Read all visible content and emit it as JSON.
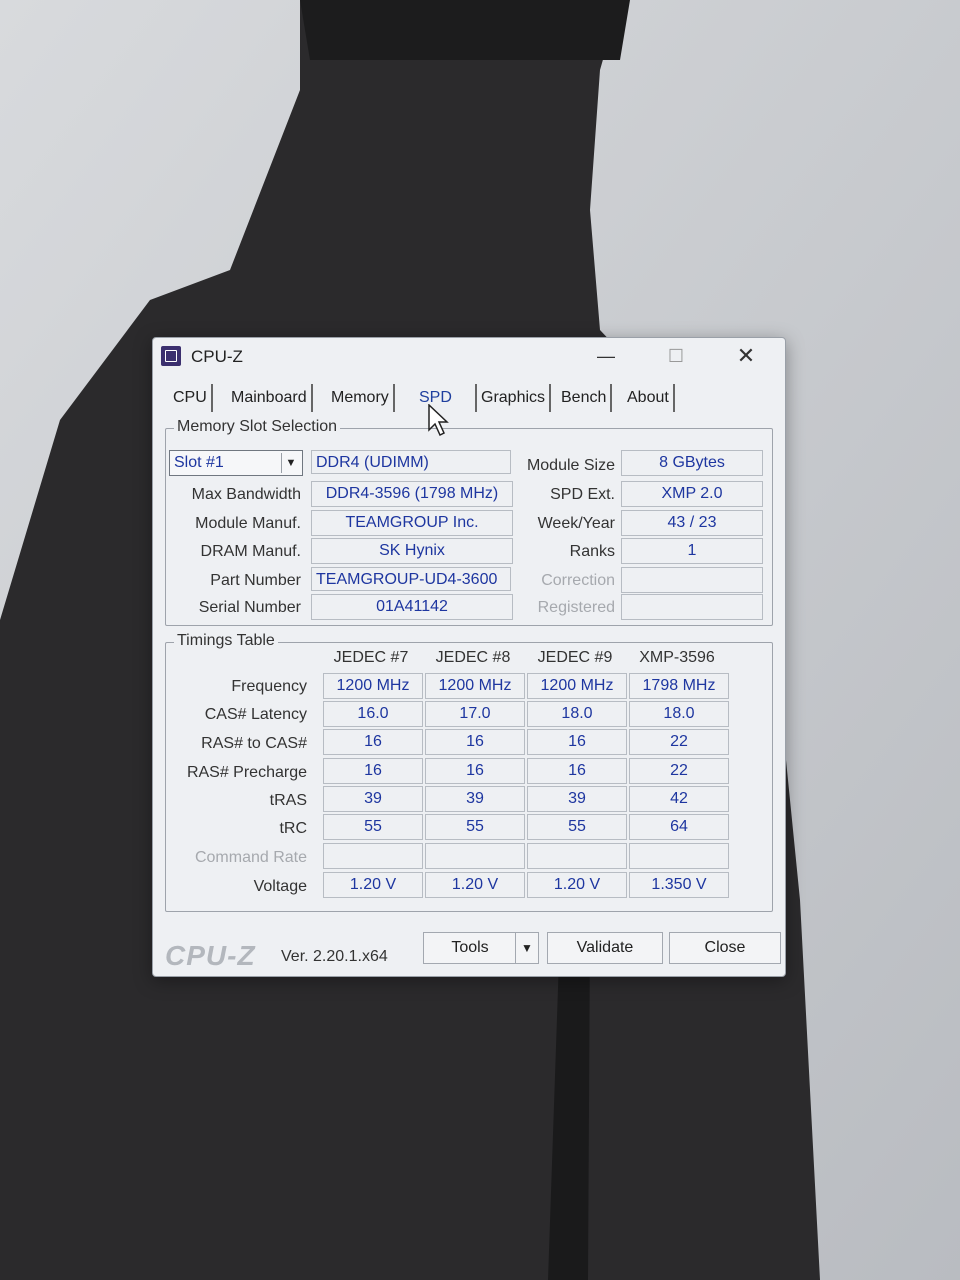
{
  "window": {
    "title": "CPU-Z"
  },
  "tabs": [
    "CPU",
    "Mainboard",
    "Memory",
    "SPD",
    "Graphics",
    "Bench",
    "About"
  ],
  "active_tab": "SPD",
  "slot_section": {
    "label": "Memory Slot Selection",
    "slot_value": "Slot #1",
    "module_type": "DDR4 (UDIMM)",
    "fields": {
      "max_bandwidth": {
        "label": "Max Bandwidth",
        "value": "DDR4-3596 (1798 MHz)"
      },
      "module_manuf": {
        "label": "Module Manuf.",
        "value": "TEAMGROUP Inc."
      },
      "dram_manuf": {
        "label": "DRAM Manuf.",
        "value": "SK Hynix"
      },
      "part_number": {
        "label": "Part Number",
        "value": "TEAMGROUP-UD4-3600"
      },
      "serial_number": {
        "label": "Serial Number",
        "value": "01A41142"
      },
      "module_size": {
        "label": "Module Size",
        "value": "8 GBytes"
      },
      "spd_ext": {
        "label": "SPD Ext.",
        "value": "XMP 2.0"
      },
      "week_year": {
        "label": "Week/Year",
        "value": "43 / 23"
      },
      "ranks": {
        "label": "Ranks",
        "value": "1"
      },
      "correction": {
        "label": "Correction",
        "value": ""
      },
      "registered": {
        "label": "Registered",
        "value": ""
      }
    }
  },
  "timings": {
    "label": "Timings Table",
    "columns": [
      "JEDEC #7",
      "JEDEC #8",
      "JEDEC #9",
      "XMP-3596"
    ],
    "rows": [
      {
        "label": "Frequency",
        "values": [
          "1200 MHz",
          "1200 MHz",
          "1200 MHz",
          "1798 MHz"
        ]
      },
      {
        "label": "CAS# Latency",
        "values": [
          "16.0",
          "17.0",
          "18.0",
          "18.0"
        ]
      },
      {
        "label": "RAS# to CAS#",
        "values": [
          "16",
          "16",
          "16",
          "22"
        ]
      },
      {
        "label": "RAS# Precharge",
        "values": [
          "16",
          "16",
          "16",
          "22"
        ]
      },
      {
        "label": "tRAS",
        "values": [
          "39",
          "39",
          "39",
          "42"
        ]
      },
      {
        "label": "tRC",
        "values": [
          "55",
          "55",
          "55",
          "64"
        ]
      },
      {
        "label": "Command Rate",
        "values": [
          "",
          "",
          "",
          ""
        ]
      },
      {
        "label": "Voltage",
        "values": [
          "1.20 V",
          "1.20 V",
          "1.20 V",
          "1.350 V"
        ]
      }
    ]
  },
  "footer": {
    "brand": "CPU-Z",
    "version": "Ver. 2.20.1.x64",
    "tools_label": "Tools",
    "validate_label": "Validate",
    "close_label": "Close"
  }
}
